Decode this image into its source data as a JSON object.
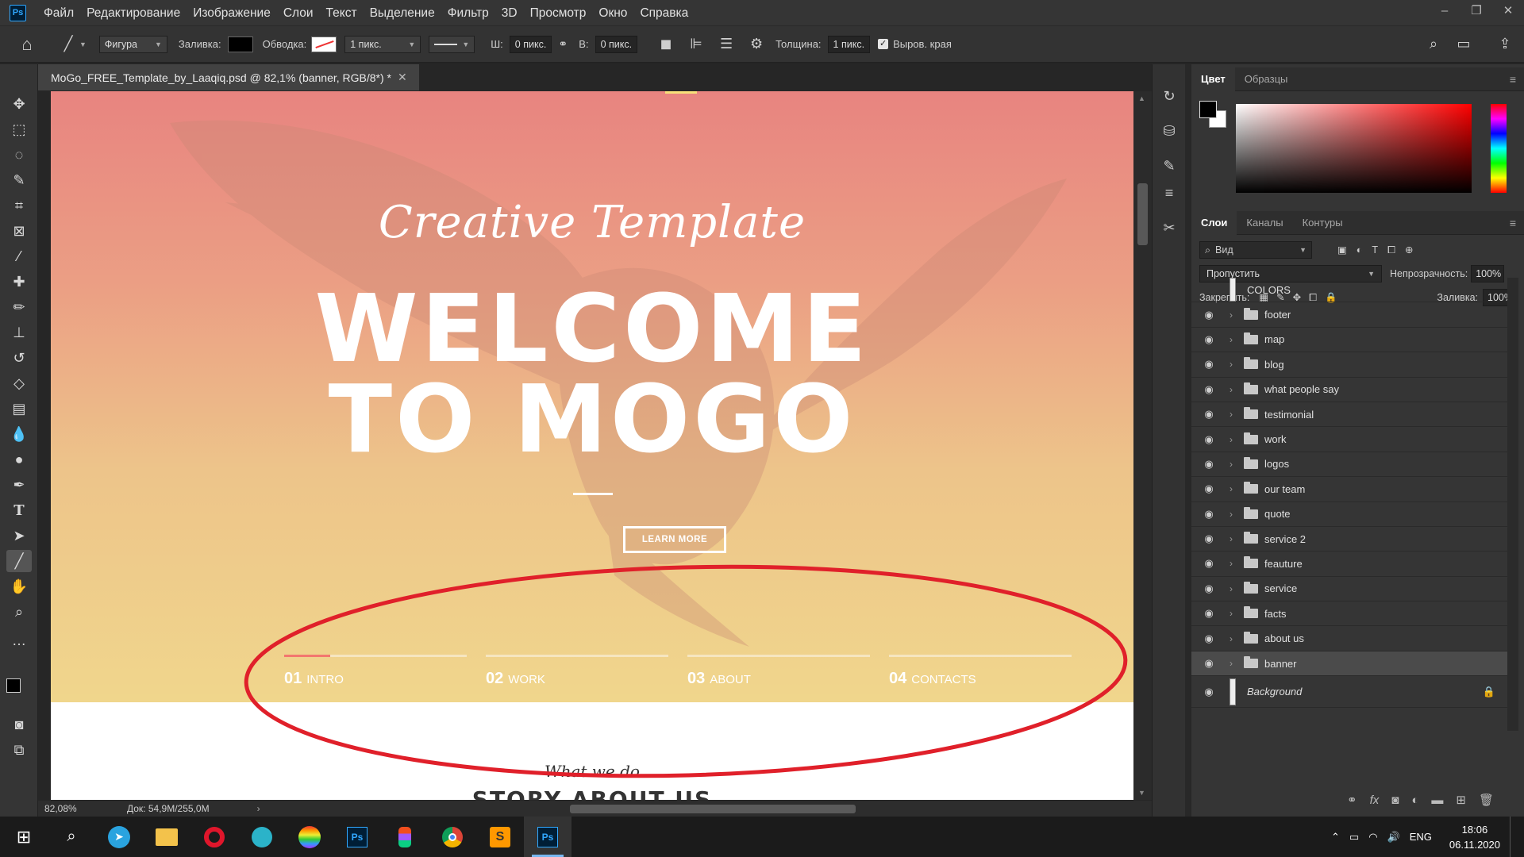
{
  "app": {
    "menu": [
      "Файл",
      "Редактирование",
      "Изображение",
      "Слои",
      "Текст",
      "Выделение",
      "Фильтр",
      "3D",
      "Просмотр",
      "Окно",
      "Справка"
    ],
    "logo": "Ps"
  },
  "options_bar": {
    "shape_mode": "Фигура",
    "fill_label": "Заливка:",
    "stroke_label": "Обводка:",
    "stroke_width": "1 пикс.",
    "w_label": "Ш:",
    "w_value": "0 пикс.",
    "h_label": "В:",
    "h_value": "0 пикс.",
    "weight_label": "Толщина:",
    "weight_value": "1 пикс.",
    "align_edges_label": "Выров. края"
  },
  "document": {
    "tab_title": "MoGo_FREE_Template_by_Laaqiq.psd @ 82,1% (banner, RGB/8*) *",
    "zoom": "82,08%",
    "doc_size": "Док: 54,9M/255,0M"
  },
  "canvas": {
    "script_title": "Creative Template",
    "title_line1": "WELCOME",
    "title_line2": "TO MOGO",
    "button": "LEARN MORE",
    "nav": [
      {
        "num": "01",
        "label": "INTRO",
        "progress": 0.25
      },
      {
        "num": "02",
        "label": "WORK",
        "progress": 0
      },
      {
        "num": "03",
        "label": "ABOUT",
        "progress": 0
      },
      {
        "num": "04",
        "label": "CONTACTS",
        "progress": 0
      }
    ],
    "sub_script": "What we do",
    "sub_heading": "STORY ABOUT US"
  },
  "color_panel": {
    "tabs": [
      "Цвет",
      "Образцы"
    ],
    "foreground": "#000000",
    "background": "#ffffff"
  },
  "layers_panel": {
    "tabs": [
      "Слои",
      "Каналы",
      "Контуры"
    ],
    "filter": "Вид",
    "blend_mode": "Пропустить",
    "opacity_label": "Непрозрачность:",
    "opacity": "100%",
    "lock_label": "Закрепить:",
    "fill_label": "Заливка:",
    "fill": "100%",
    "layers": [
      {
        "name": "COLORS",
        "type": "layer",
        "visible": false
      },
      {
        "name": "footer",
        "type": "group",
        "visible": true
      },
      {
        "name": "map",
        "type": "group",
        "visible": true
      },
      {
        "name": "blog",
        "type": "group",
        "visible": true
      },
      {
        "name": "what people say",
        "type": "group",
        "visible": true
      },
      {
        "name": "testimonial",
        "type": "group",
        "visible": true
      },
      {
        "name": "work",
        "type": "group",
        "visible": true
      },
      {
        "name": "logos",
        "type": "group",
        "visible": true
      },
      {
        "name": "our team",
        "type": "group",
        "visible": true
      },
      {
        "name": "quote",
        "type": "group",
        "visible": true
      },
      {
        "name": "service 2",
        "type": "group",
        "visible": true
      },
      {
        "name": "feauture",
        "type": "group",
        "visible": true
      },
      {
        "name": "service",
        "type": "group",
        "visible": true
      },
      {
        "name": "facts",
        "type": "group",
        "visible": true
      },
      {
        "name": "about us",
        "type": "group",
        "visible": true
      },
      {
        "name": "banner",
        "type": "group",
        "visible": true,
        "selected": true
      },
      {
        "name": "Background",
        "type": "background",
        "visible": true,
        "locked": true
      }
    ]
  },
  "taskbar": {
    "lang": "ENG",
    "time": "18:06",
    "date": "06.11.2020",
    "apps": [
      "telegram",
      "file-explorer",
      "opera",
      "app",
      "color-app",
      "photoshop",
      "figma",
      "chrome",
      "sublime-text",
      "photoshop"
    ]
  },
  "colors": {
    "accent": "#31a8ff",
    "annotation": "#e0202a",
    "nav_active": "#f3776f"
  }
}
